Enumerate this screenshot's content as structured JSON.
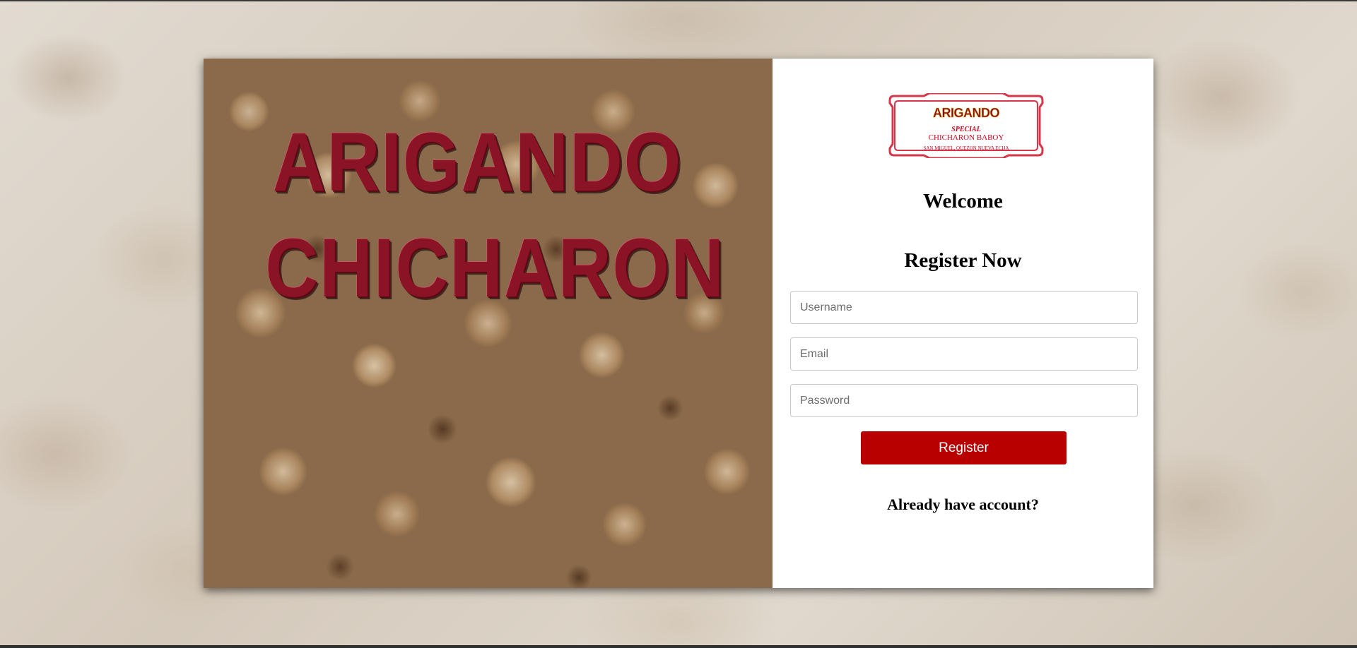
{
  "hero": {
    "title_line1": "ARIGANDO",
    "title_line2": "CHICHARON"
  },
  "logo": {
    "brand": "ARIGANDO",
    "special": "SPECIAL",
    "product": "CHICHARON BABOY",
    "location": "SAN MIGUEL, QUEZON NUEVA ECIJA"
  },
  "form": {
    "welcome": "Welcome",
    "title": "Register Now",
    "username_placeholder": "Username",
    "email_placeholder": "Email",
    "password_placeholder": "Password",
    "register_label": "Register",
    "login_link": "Already have account?"
  },
  "colors": {
    "accent": "#b80000",
    "logo_red": "#d5364a",
    "title_red": "#8a1425"
  }
}
